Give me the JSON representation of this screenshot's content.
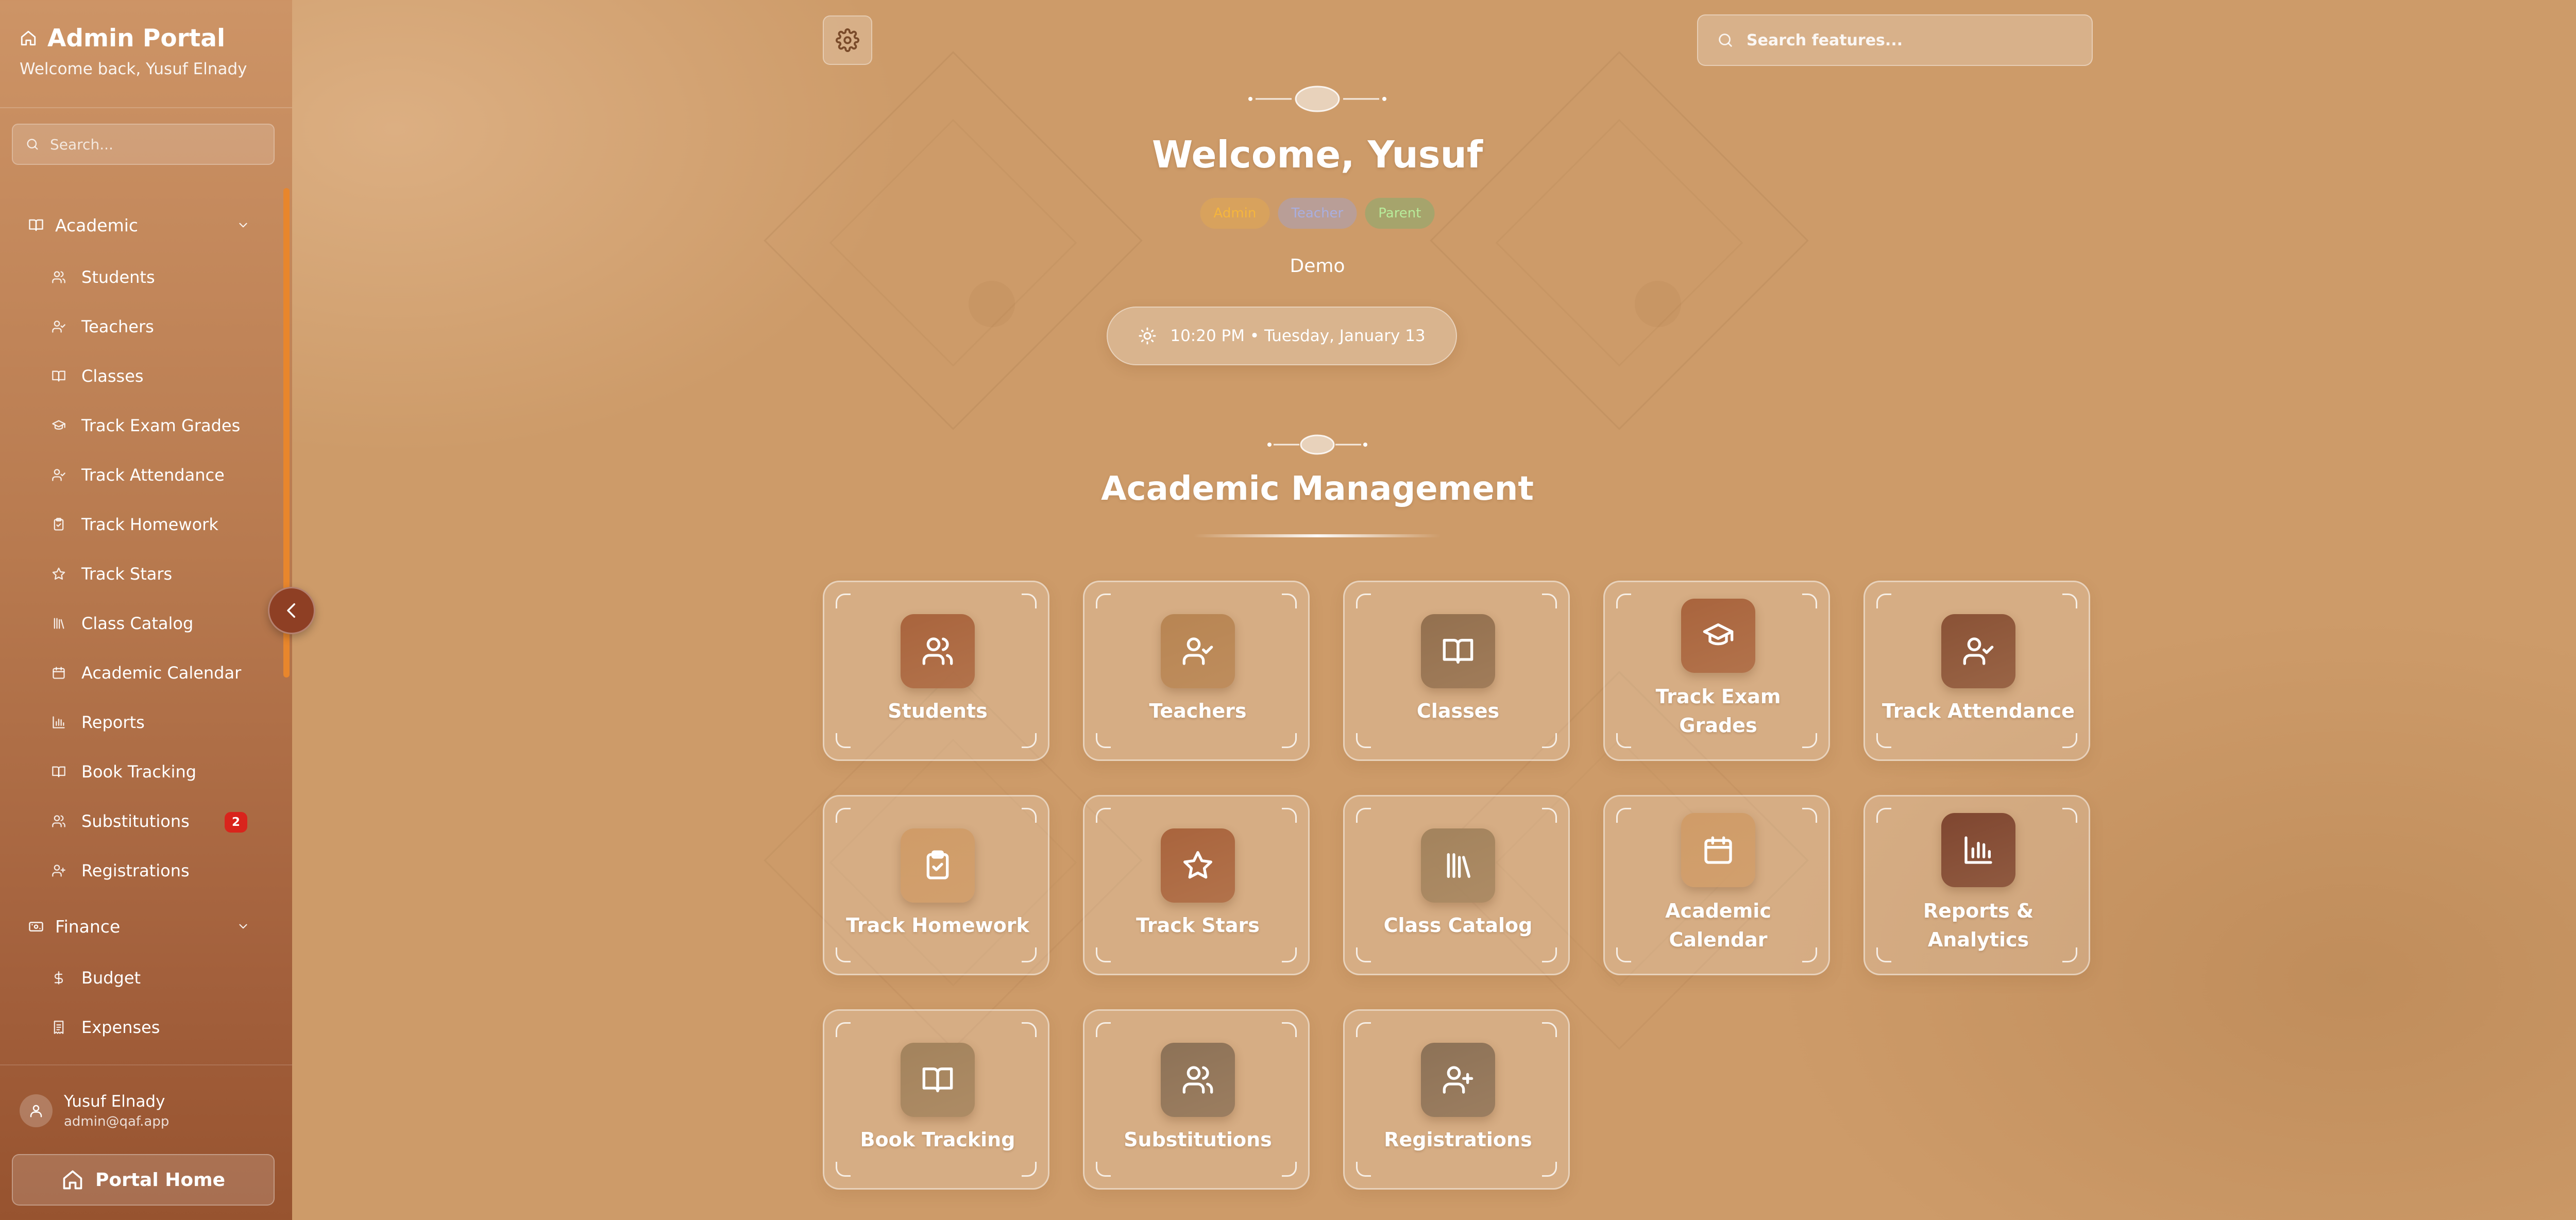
{
  "sidebar": {
    "title": "Admin Portal",
    "welcome": "Welcome back, Yusuf Elnady",
    "search_placeholder": "Search...",
    "sections": [
      {
        "label": "Academic",
        "items": [
          {
            "label": "Students",
            "icon": "users-icon"
          },
          {
            "label": "Teachers",
            "icon": "user-check-icon"
          },
          {
            "label": "Classes",
            "icon": "book-open-icon"
          },
          {
            "label": "Track Exam Grades",
            "icon": "graduation-cap-icon"
          },
          {
            "label": "Track Attendance",
            "icon": "user-check-icon"
          },
          {
            "label": "Track Homework",
            "icon": "clipboard-check-icon"
          },
          {
            "label": "Track Stars",
            "icon": "star-icon"
          },
          {
            "label": "Class Catalog",
            "icon": "library-icon"
          },
          {
            "label": "Academic Calendar",
            "icon": "calendar-icon"
          },
          {
            "label": "Reports",
            "icon": "bar-chart-icon"
          },
          {
            "label": "Book Tracking",
            "icon": "book-open-icon"
          },
          {
            "label": "Substitutions",
            "icon": "users-icon",
            "badge": "2"
          },
          {
            "label": "Registrations",
            "icon": "user-plus-icon"
          }
        ]
      },
      {
        "label": "Finance",
        "items": [
          {
            "label": "Budget",
            "icon": "dollar-icon"
          },
          {
            "label": "Expenses",
            "icon": "receipt-icon"
          }
        ]
      }
    ],
    "user": {
      "name": "Yusuf Elnady",
      "email": "admin@qaf.app"
    },
    "portal_home_label": "Portal Home"
  },
  "header": {
    "search_placeholder": "Search features..."
  },
  "hero": {
    "title": "Welcome, Yusuf",
    "roles": [
      "Admin",
      "Teacher",
      "Parent"
    ],
    "subtitle": "Demo",
    "datetime": "10:20 PM • Tuesday, January 13"
  },
  "section": {
    "title": "Academic Management",
    "cards": [
      {
        "label": "Students",
        "icon": "users-icon",
        "color": "#a9643d"
      },
      {
        "label": "Teachers",
        "icon": "user-check-icon",
        "color": "#b88553"
      },
      {
        "label": "Classes",
        "icon": "book-open-icon",
        "color": "#93704f"
      },
      {
        "label": "Track Exam Grades",
        "icon": "graduation-cap-icon",
        "color": "#a9643d"
      },
      {
        "label": "Track Attendance",
        "icon": "user-check-icon",
        "color": "#8a5236"
      },
      {
        "label": "Track Homework",
        "icon": "clipboard-check-icon",
        "color": "#d09c68"
      },
      {
        "label": "Track Stars",
        "icon": "star-icon",
        "color": "#a9643d"
      },
      {
        "label": "Class Catalog",
        "icon": "library-icon",
        "color": "#a3835d"
      },
      {
        "label": "Academic Calendar",
        "icon": "calendar-icon",
        "color": "#d09c68"
      },
      {
        "label": "Reports & Analytics",
        "icon": "bar-chart-icon",
        "color": "#7f4630"
      },
      {
        "label": "Book Tracking",
        "icon": "book-open-icon",
        "color": "#a3835d"
      },
      {
        "label": "Substitutions",
        "icon": "users-icon",
        "color": "#8d7257"
      },
      {
        "label": "Registrations",
        "icon": "user-plus-icon",
        "color": "#8d7257"
      }
    ]
  }
}
